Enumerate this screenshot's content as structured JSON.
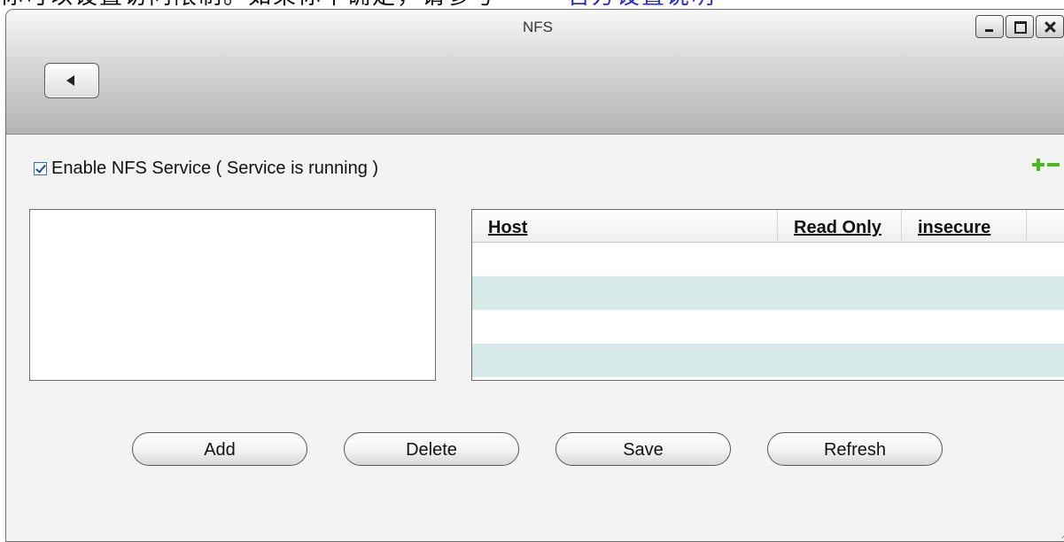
{
  "top_fragment": {
    "text": "你可以设置访问限制。如果你不确定，请参考",
    "link": "官方设置说明"
  },
  "window": {
    "title": "NFS"
  },
  "nfs": {
    "enable_label": "Enable NFS Service ( Service is running )",
    "enabled": true
  },
  "table": {
    "columns": [
      "Host",
      "Read Only",
      "insecure"
    ],
    "rows": []
  },
  "buttons": {
    "add": "Add",
    "delete": "Delete",
    "save": "Save",
    "refresh": "Refresh"
  },
  "colors": {
    "alt_row": "#d6eaea",
    "accent_green": "#4cb81f"
  }
}
